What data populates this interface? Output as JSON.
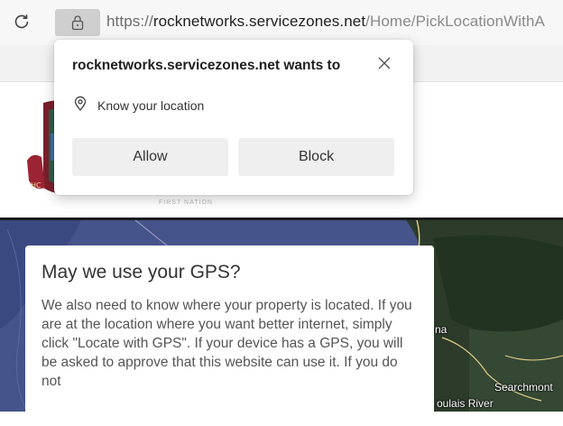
{
  "browser": {
    "url": {
      "scheme": "https://",
      "host": "rocknetworks.servicezones.net",
      "path": "/Home/PickLocationWithA"
    }
  },
  "header": {
    "logo_caption": "FIRST NATION"
  },
  "permission_prompt": {
    "title": "rocknetworks.servicezones.net wants to",
    "permission_label": "Know your location",
    "allow_label": "Allow",
    "block_label": "Block"
  },
  "gps_card": {
    "title": "May we use your GPS?",
    "body": "We also need to know where your property is located. If you are at the location where you want better internet, simply click \"Locate with GPS\". If your device has a GPS, you will be asked to approve that this website can use it. If you do not"
  },
  "map": {
    "labels": {
      "na": "na",
      "searchmont": "Searchmont",
      "goulais_river": "oulais River"
    }
  }
}
